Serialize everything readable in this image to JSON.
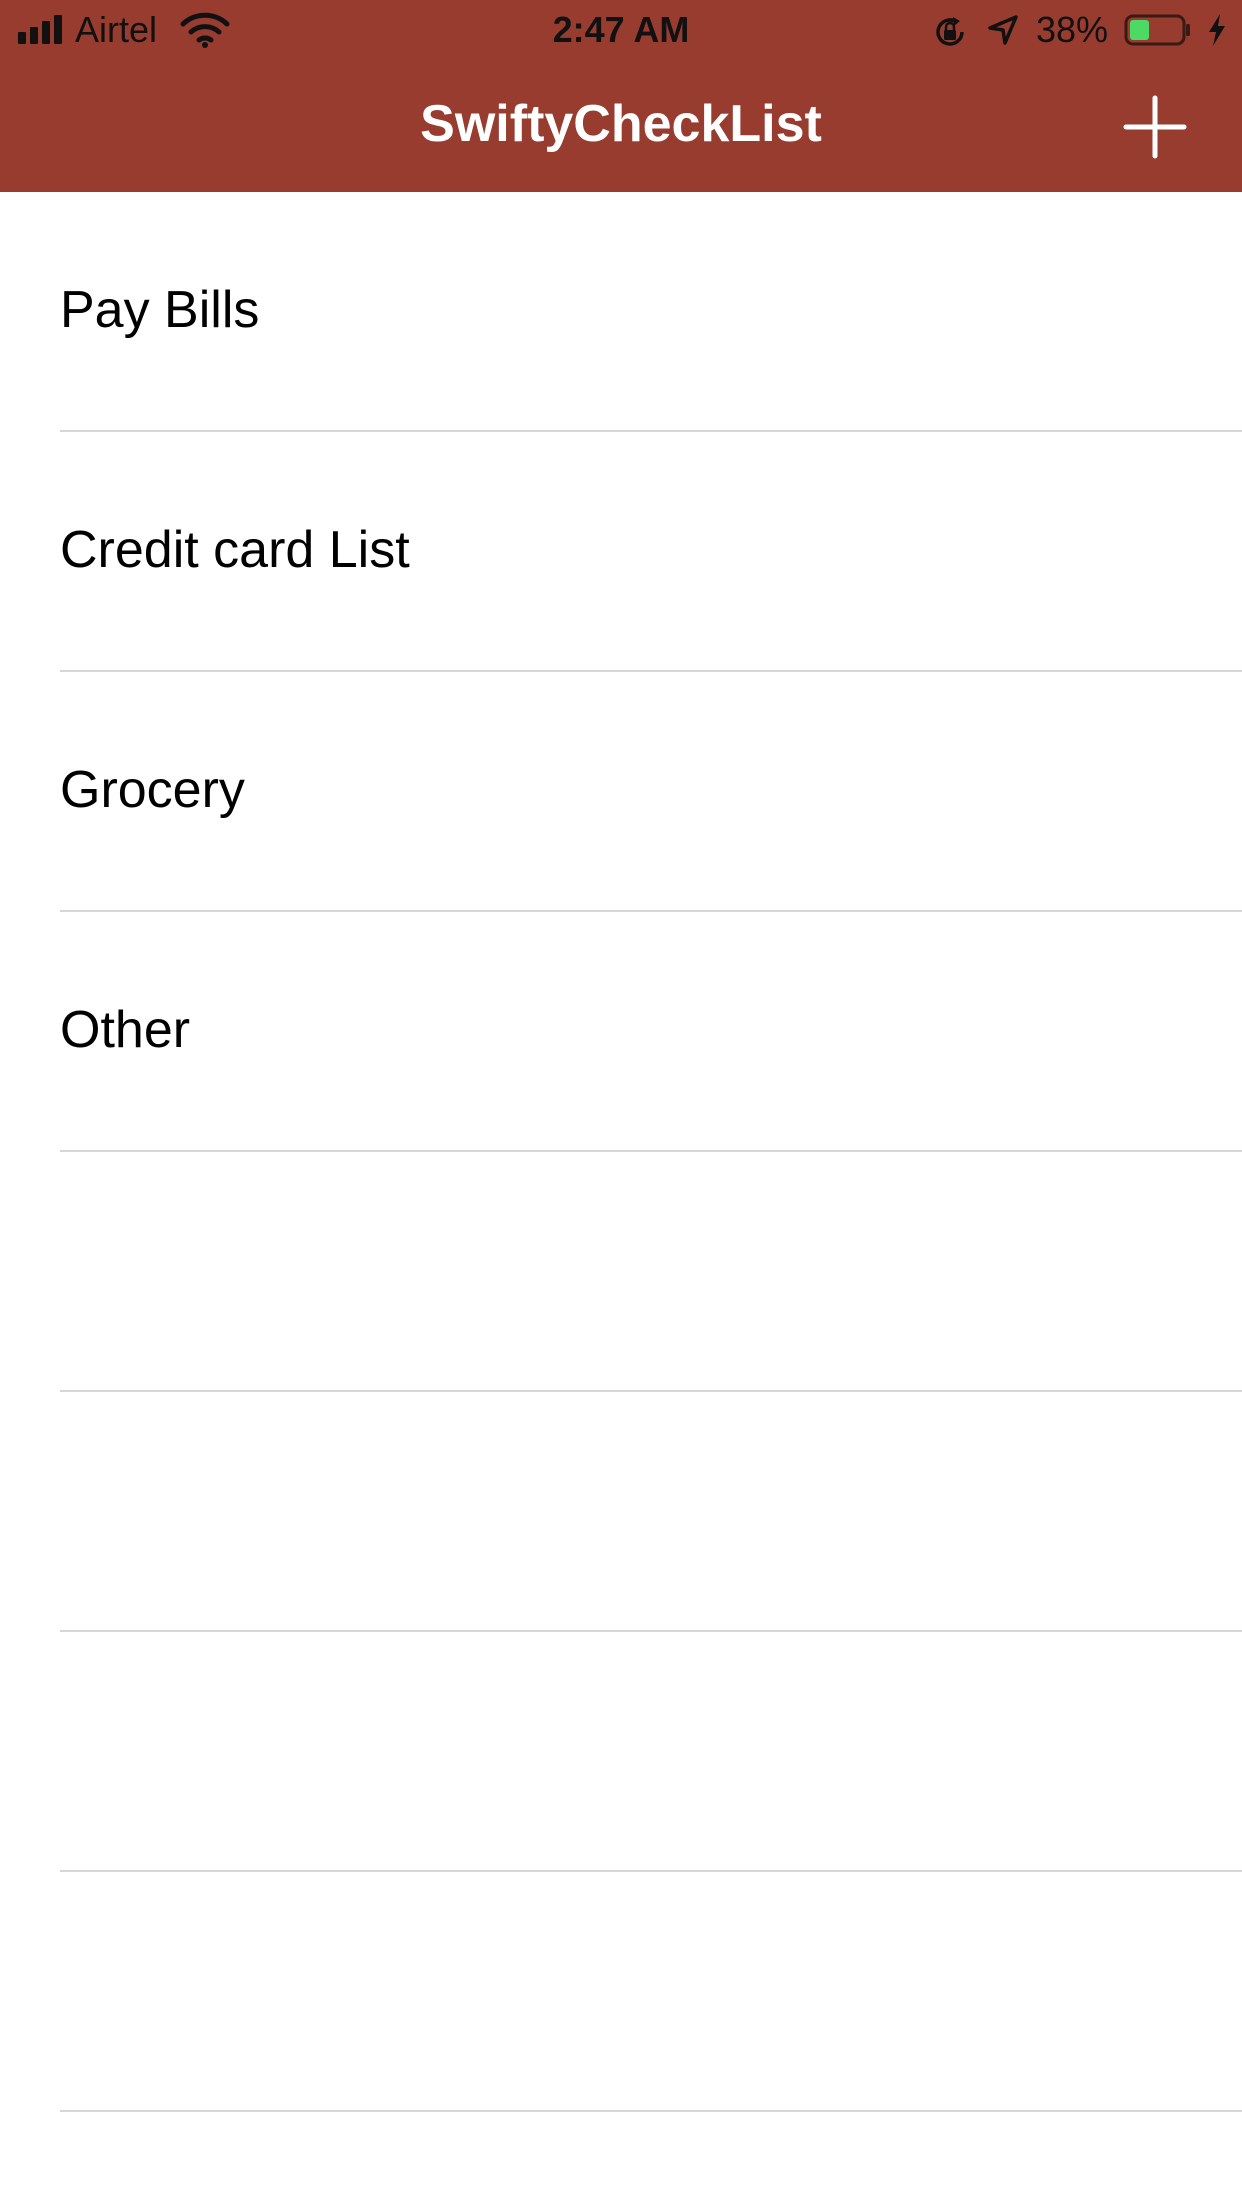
{
  "status_bar": {
    "carrier": "Airtel",
    "time": "2:47 AM",
    "battery_percent": "38%",
    "battery_level": 0.38,
    "battery_fill_color": "#4cd964",
    "icons": [
      "signal-bars-icon",
      "wifi-icon",
      "rotation-lock-icon",
      "location-arrow-icon",
      "battery-icon",
      "charging-bolt-icon"
    ]
  },
  "nav_bar": {
    "title": "SwiftyCheckList",
    "background_color": "#973c2f",
    "add_button_icon": "plus-icon"
  },
  "list": {
    "items": [
      {
        "label": "Pay Bills"
      },
      {
        "label": "Credit card List"
      },
      {
        "label": "Grocery"
      },
      {
        "label": "Other"
      },
      {
        "label": ""
      },
      {
        "label": ""
      },
      {
        "label": ""
      },
      {
        "label": ""
      }
    ]
  }
}
